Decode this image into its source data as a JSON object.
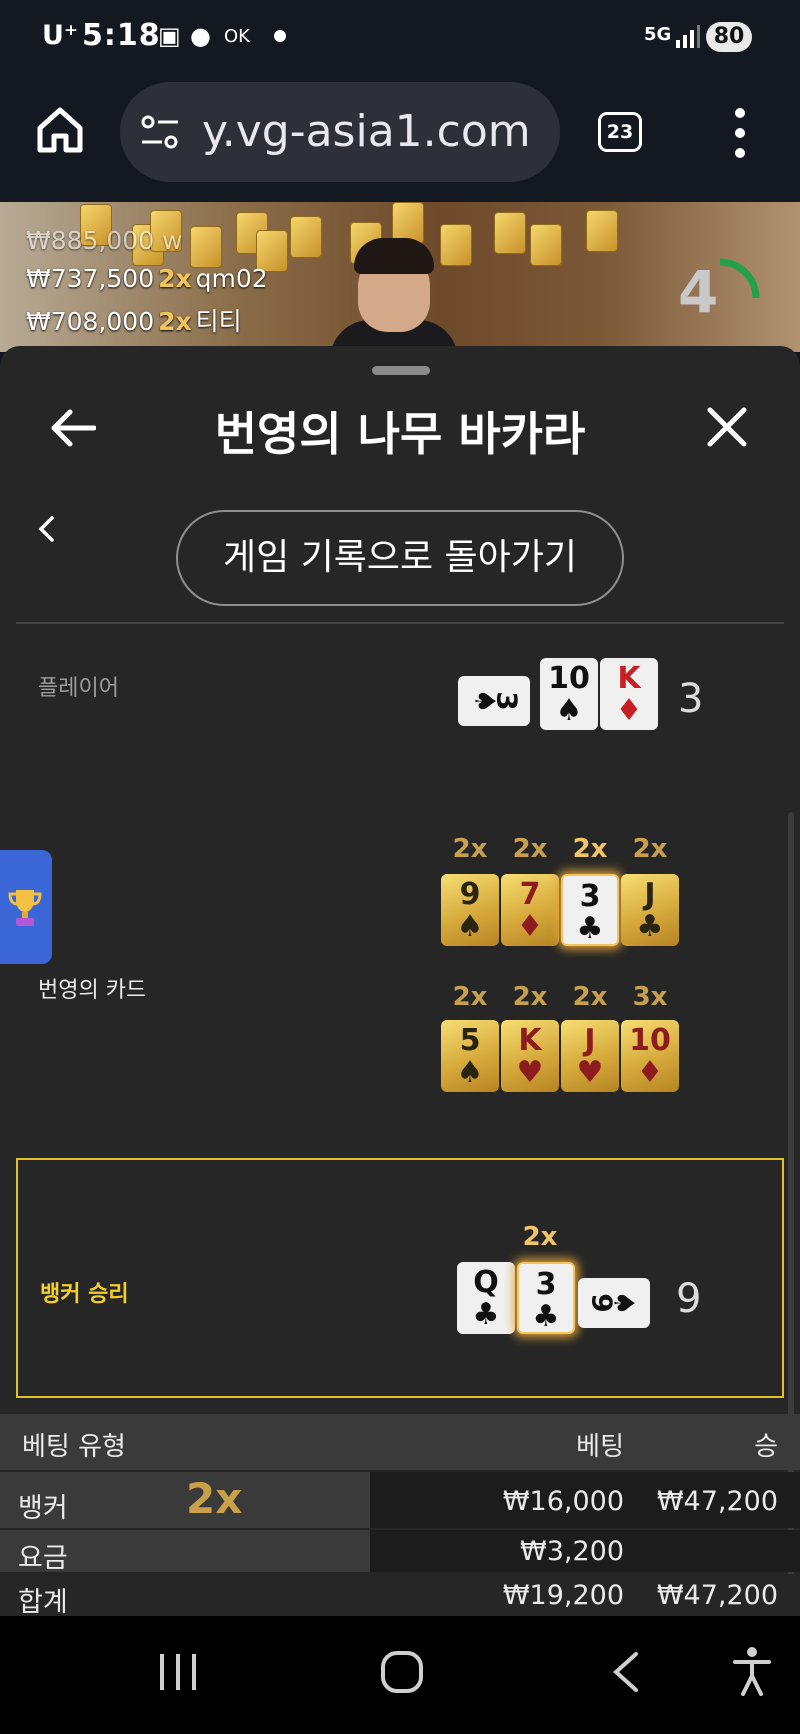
{
  "status_bar": {
    "carrier": "U⁺",
    "time": "5:18",
    "network": "5G",
    "battery": "80"
  },
  "browser": {
    "url": "y.vg-asia1.com",
    "tab_count": "23"
  },
  "video": {
    "winners": [
      {
        "amount": "₩885,000",
        "mult": "",
        "name": "w"
      },
      {
        "amount": "₩737,500",
        "mult": "2x",
        "name": "qm02"
      },
      {
        "amount": "₩708,000",
        "mult": "2x",
        "name": "티티"
      }
    ],
    "timer": "4"
  },
  "sheet": {
    "title": "번영의 나무 바카라",
    "back_to_history": "게임 기록으로 돌아가기"
  },
  "player": {
    "label": "플레이어",
    "score": "3",
    "cards": [
      {
        "rank": "3",
        "suit": "♠",
        "red": false,
        "side": true
      },
      {
        "rank": "10",
        "suit": "♠",
        "red": false,
        "side": false
      },
      {
        "rank": "K",
        "suit": "♦",
        "red": true,
        "side": false
      }
    ]
  },
  "prosperity": {
    "label": "번영의 카드",
    "row1": [
      {
        "mult": "2x",
        "rank": "9",
        "suit": "♠",
        "red": false,
        "highlight": false
      },
      {
        "mult": "2x",
        "rank": "7",
        "suit": "♦",
        "red": true,
        "highlight": false
      },
      {
        "mult": "2x",
        "rank": "3",
        "suit": "♣",
        "red": false,
        "highlight": true
      },
      {
        "mult": "2x",
        "rank": "J",
        "suit": "♣",
        "red": false,
        "highlight": false
      }
    ],
    "row2": [
      {
        "mult": "2x",
        "rank": "5",
        "suit": "♠",
        "red": false,
        "highlight": false
      },
      {
        "mult": "2x",
        "rank": "K",
        "suit": "♥",
        "red": true,
        "highlight": false
      },
      {
        "mult": "2x",
        "rank": "J",
        "suit": "♥",
        "red": true,
        "highlight": false
      },
      {
        "mult": "3x",
        "rank": "10",
        "suit": "♦",
        "red": true,
        "highlight": false
      }
    ]
  },
  "banker": {
    "label": "뱅커 승리",
    "score": "9",
    "mult": "2x",
    "cards": [
      {
        "rank": "Q",
        "suit": "♣",
        "red": false,
        "side": false
      },
      {
        "rank": "3",
        "suit": "♣",
        "red": false,
        "side": false,
        "highlight": true
      },
      {
        "rank": "9",
        "suit": "♠",
        "red": false,
        "side": true
      }
    ]
  },
  "bet_table": {
    "headers": {
      "type": "베팅 유형",
      "bet": "베팅",
      "win": "승"
    },
    "rows": [
      {
        "type": "뱅커",
        "mult": "2x",
        "bet": "₩16,000",
        "win": "₩47,200"
      },
      {
        "type": "요금",
        "mult": "",
        "bet": "₩3,200",
        "win": ""
      },
      {
        "type": "합계",
        "mult": "",
        "bet": "₩19,200",
        "win": "₩47,200"
      }
    ]
  },
  "colors": {
    "accent_gold": "#f3cf2a",
    "multiplier_gold": "#c6a04f",
    "trophy_tab": "#3a66d6"
  }
}
